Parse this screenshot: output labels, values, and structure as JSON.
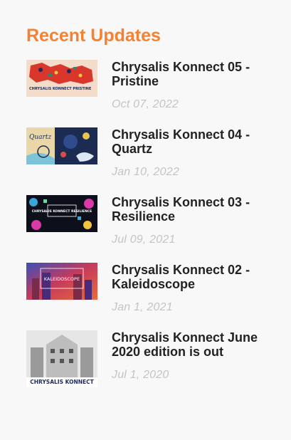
{
  "widget": {
    "title": "Recent Updates",
    "title_color": "#f58232"
  },
  "posts": [
    {
      "title": "Chrysalis Konnect 05 - Pristine",
      "date": "Oct 07, 2022",
      "thumb_text": "CHRYSALIS KONNECT PRISTINE"
    },
    {
      "title": "Chrysalis Konnect 04 - Quartz",
      "date": "Jan 10, 2022",
      "thumb_text": "Quartz"
    },
    {
      "title": "Chrysalis Konnect 03 - Resilience",
      "date": "Jul 09, 2021",
      "thumb_text": "CHRYSALIS KONNECT RESILIENCE"
    },
    {
      "title": "Chrysalis Konnect 02 - Kaleidoscope",
      "date": "Jan 1, 2021",
      "thumb_text": "KALEIDOSCOPE"
    },
    {
      "title": "Chrysalis Konnect June 2020 edition is out",
      "date": "Jul 1, 2020",
      "thumb_text": "CHRYSALIS KONNECT"
    }
  ]
}
